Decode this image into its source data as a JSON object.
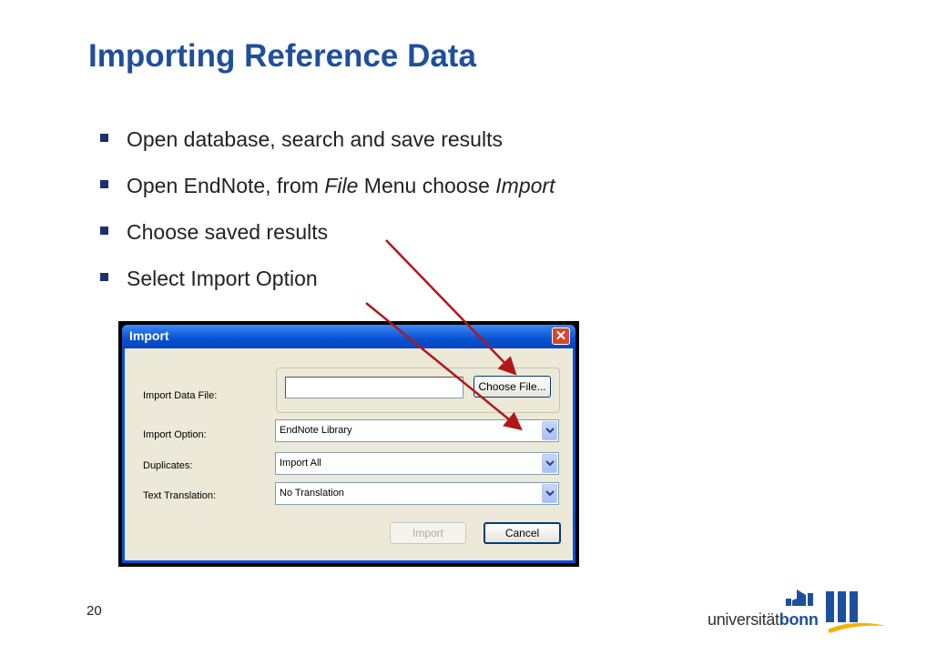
{
  "slide": {
    "title": "Importing Reference Data",
    "page_number": "20",
    "bullets": [
      {
        "text": "Open database, search and save results"
      },
      {
        "pre": "Open EndNote, from ",
        "em1": "File",
        "mid": " Menu choose ",
        "em2": "Import"
      },
      {
        "text": "Choose saved results"
      },
      {
        "text": "Select Import Option"
      }
    ]
  },
  "dialog": {
    "title": "Import",
    "close_glyph": "✕",
    "labels": {
      "import_data_file": "Import Data File:",
      "import_option": "Import Option:",
      "duplicates": "Duplicates:",
      "text_translation": "Text Translation:"
    },
    "file_input_value": "",
    "choose_file_label": "Choose File...",
    "import_option_value": "EndNote Library",
    "duplicates_value": "Import All",
    "text_translation_value": "No Translation",
    "import_button_label": "Import",
    "cancel_button_label": "Cancel"
  },
  "logo": {
    "word_light": "universität",
    "word_bold": "bonn"
  },
  "colors": {
    "title": "#1f4e9c",
    "arrow": "#b01818",
    "titlebar": "#0850d0"
  }
}
